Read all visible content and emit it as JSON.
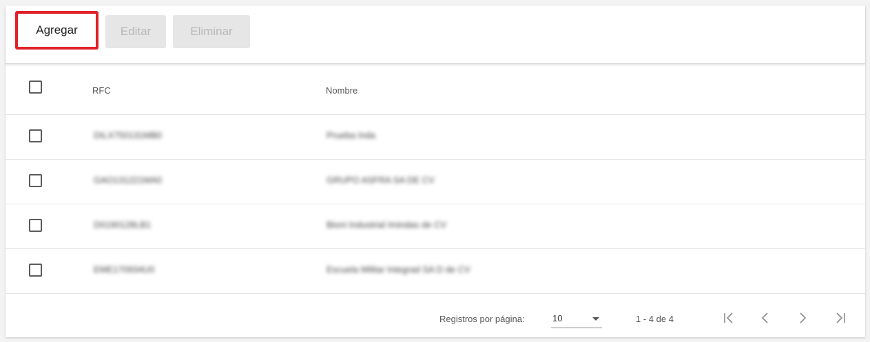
{
  "toolbar": {
    "add_label": "Agregar",
    "edit_label": "Editar",
    "delete_label": "Eliminar"
  },
  "table": {
    "columns": [
      "RFC",
      "Nombre"
    ],
    "rows": [
      {
        "rfc": "DILX750131MB0",
        "nombre": "Prueba Inda"
      },
      {
        "rfc": "GAO131221MA0",
        "nombre": "GRUPO ASFRA SA DE CV"
      },
      {
        "rfc": "DII190128LB1",
        "nombre": "Bioni Industrial Imindas de CV"
      },
      {
        "rfc": "EME170934U0",
        "nombre": "Escuela Militar Integrad SA D de CV"
      }
    ]
  },
  "footer": {
    "per_page_label": "Registros por página:",
    "per_page_value": "10",
    "range_label": "1 - 4 de 4"
  },
  "icons": {
    "first": "first-page-icon",
    "prev": "prev-page-icon",
    "next": "next-page-icon",
    "last": "last-page-icon"
  },
  "colors": {
    "highlight": "#e0202a",
    "disabled_bg": "#e6e6e6",
    "disabled_text": "#b8b8b8"
  }
}
